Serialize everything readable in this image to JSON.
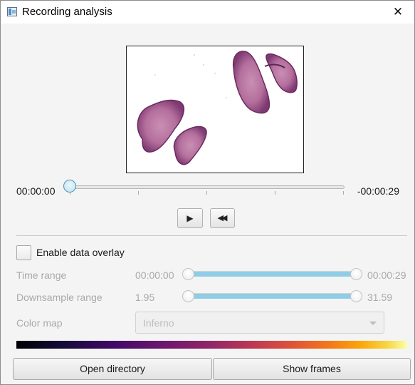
{
  "window": {
    "title": "Recording analysis",
    "close_glyph": "✕"
  },
  "player": {
    "time_start": "00:00:00",
    "time_end": "-00:00:29",
    "position_fraction": 0.0,
    "play_glyph": "▶",
    "rewind_glyph": "◀◀"
  },
  "overlay": {
    "enable_label": "Enable data overlay",
    "enabled": false,
    "time_range": {
      "label": "Time range",
      "min": "00:00:00",
      "max": "00:00:29"
    },
    "downsample_range": {
      "label": "Downsample range",
      "min": "1.95",
      "max": "31.59"
    },
    "color_map": {
      "label": "Color map",
      "value": "Inferno"
    }
  },
  "buttons": {
    "open_directory": "Open directory",
    "show_frames": "Show frames"
  },
  "colors": {
    "accent": "#8fcde6",
    "thumb_border": "#4c93b7"
  }
}
